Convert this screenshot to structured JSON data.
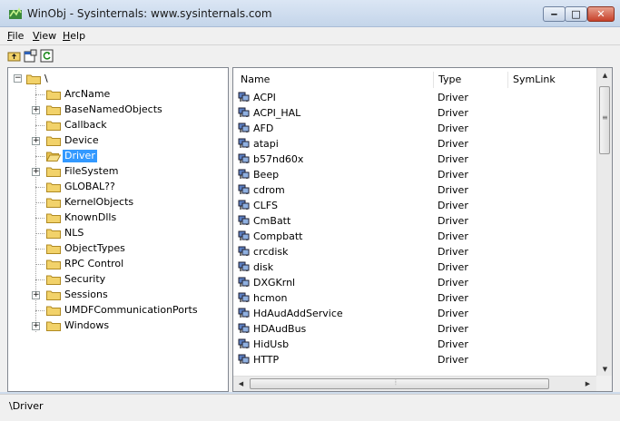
{
  "window": {
    "title": "WinObj - Sysinternals: www.sysinternals.com"
  },
  "menu": [
    {
      "label": "File",
      "accel": "F",
      "rest": "ile"
    },
    {
      "label": "View",
      "accel": "V",
      "rest": "iew"
    },
    {
      "label": "Help",
      "accel": "H",
      "rest": "elp"
    }
  ],
  "toolbar": [
    "up-folder-icon",
    "properties-icon",
    "refresh-icon"
  ],
  "tree": {
    "root": "\\",
    "items": [
      {
        "label": "ArcName",
        "expandable": false
      },
      {
        "label": "BaseNamedObjects",
        "expandable": true
      },
      {
        "label": "Callback",
        "expandable": false
      },
      {
        "label": "Device",
        "expandable": true
      },
      {
        "label": "Driver",
        "expandable": false,
        "selected": true
      },
      {
        "label": "FileSystem",
        "expandable": true
      },
      {
        "label": "GLOBAL??",
        "expandable": false
      },
      {
        "label": "KernelObjects",
        "expandable": false
      },
      {
        "label": "KnownDlls",
        "expandable": false
      },
      {
        "label": "NLS",
        "expandable": false
      },
      {
        "label": "ObjectTypes",
        "expandable": false
      },
      {
        "label": "RPC Control",
        "expandable": false
      },
      {
        "label": "Security",
        "expandable": false
      },
      {
        "label": "Sessions",
        "expandable": true
      },
      {
        "label": "UMDFCommunicationPorts",
        "expandable": false
      },
      {
        "label": "Windows",
        "expandable": true
      }
    ]
  },
  "list": {
    "columns": [
      "Name",
      "Type",
      "SymLink"
    ],
    "rows": [
      {
        "name": "ACPI",
        "type": "Driver"
      },
      {
        "name": "ACPI_HAL",
        "type": "Driver"
      },
      {
        "name": "AFD",
        "type": "Driver"
      },
      {
        "name": "atapi",
        "type": "Driver"
      },
      {
        "name": "b57nd60x",
        "type": "Driver"
      },
      {
        "name": "Beep",
        "type": "Driver"
      },
      {
        "name": "cdrom",
        "type": "Driver"
      },
      {
        "name": "CLFS",
        "type": "Driver"
      },
      {
        "name": "CmBatt",
        "type": "Driver"
      },
      {
        "name": "Compbatt",
        "type": "Driver"
      },
      {
        "name": "crcdisk",
        "type": "Driver"
      },
      {
        "name": "disk",
        "type": "Driver"
      },
      {
        "name": "DXGKrnl",
        "type": "Driver"
      },
      {
        "name": "hcmon",
        "type": "Driver"
      },
      {
        "name": "HdAudAddService",
        "type": "Driver"
      },
      {
        "name": "HDAudBus",
        "type": "Driver"
      },
      {
        "name": "HidUsb",
        "type": "Driver"
      },
      {
        "name": "HTTP",
        "type": "Driver"
      }
    ]
  },
  "status": {
    "path": "\\Driver"
  },
  "colors": {
    "selection": "#3399ff",
    "folder": "#f2d26a"
  }
}
